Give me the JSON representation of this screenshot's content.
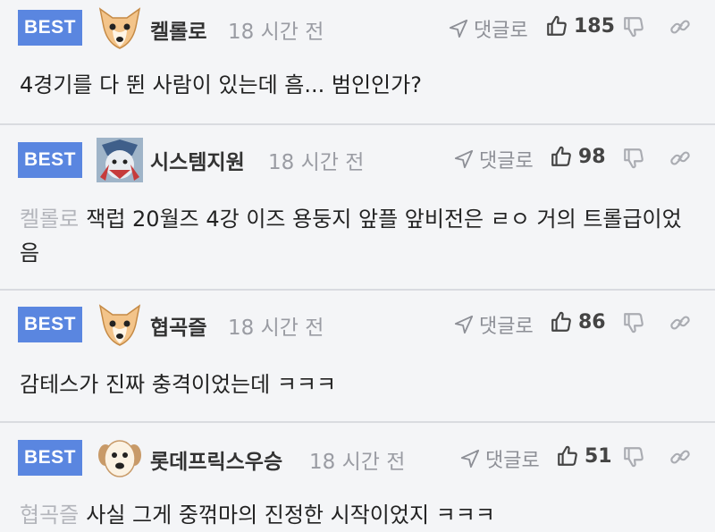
{
  "comments": [
    {
      "badge": "BEST",
      "author": "켈롤로",
      "time": "18 시간 전",
      "reply_label": "댓글로",
      "likes": "185",
      "mention": "",
      "text": "4경기를 다 뛴 사람이 있는데 흠... 범인인가?"
    },
    {
      "badge": "BEST",
      "author": "시스템지원",
      "time": "18 시간 전",
      "reply_label": "댓글로",
      "likes": "98",
      "mention": "켈롤로",
      "text": "잭럽 20월즈 4강 이즈 용둥지 앞플 앞비전은 ㄹㅇ 거의 트롤급이었음"
    },
    {
      "badge": "BEST",
      "author": "협곡즐",
      "time": "18 시간 전",
      "reply_label": "댓글로",
      "likes": "86",
      "mention": "",
      "text": "감테스가 진짜 충격이었는데 ㅋㅋㅋ"
    },
    {
      "badge": "BEST",
      "author": "롯데프릭스우승",
      "time": "18 시간 전",
      "reply_label": "댓글로",
      "likes": "51",
      "mention": "협곡즐",
      "text": "사실 그게 중꺾마의 진정한 시작이었지 ㅋㅋㅋ"
    }
  ],
  "colors": {
    "badge": "#5a86e0",
    "background": "#f4f5f7",
    "divider": "#d9dbe0",
    "muted": "#9a9ca3"
  },
  "icons": {
    "reply": "send-arrow-icon",
    "like": "thumbs-up-icon",
    "dislike": "thumbs-down-icon",
    "share": "link-icon",
    "avatar_fox": "fox-avatar-icon",
    "avatar_clown": "clown-avatar-icon",
    "avatar_dog": "dog-avatar-icon"
  }
}
